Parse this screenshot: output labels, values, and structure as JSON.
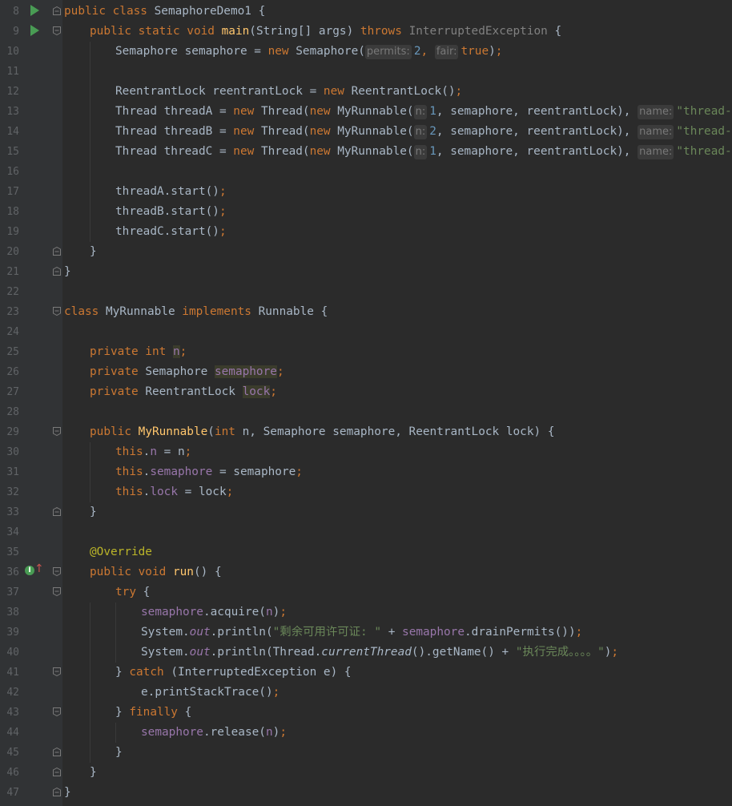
{
  "editor": {
    "line_numbers": [
      "8",
      "9",
      "10",
      "11",
      "12",
      "13",
      "14",
      "15",
      "16",
      "17",
      "18",
      "19",
      "20",
      "21",
      "22",
      "23",
      "24",
      "25",
      "26",
      "27",
      "28",
      "29",
      "30",
      "31",
      "32",
      "33",
      "34",
      "35",
      "36",
      "37",
      "38",
      "39",
      "40",
      "41",
      "42",
      "43",
      "44",
      "45",
      "46",
      "47"
    ],
    "icons": {
      "run": "run-icon",
      "override": "overridden-method-icon",
      "fold": "fold-icon"
    },
    "colors": {
      "background": "#2b2b2b",
      "gutter": "#313335",
      "line_number": "#606366",
      "keyword": "#cc7832",
      "function": "#ffc66d",
      "field": "#9876aa",
      "number": "#6897bb",
      "string": "#6a8759",
      "text": "#a9b7c6",
      "annotation": "#bbb529",
      "run_icon": "#499c54"
    }
  },
  "code": {
    "l8": {
      "t1": "public class ",
      "t2": "SemaphoreDemo1 {"
    },
    "l9": {
      "t1": "public static void ",
      "t2": "main",
      "t3": "(String[] args) ",
      "t4": "throws ",
      "t5": "InterruptedException ",
      "t6": "{"
    },
    "l10": {
      "t1": "Semaphore semaphore = ",
      "t2": "new ",
      "t3": "Semaphore(",
      "h1": "permits:",
      "t4": "2",
      "t5": ", ",
      "h2": "fair:",
      "t6": "true",
      "t7": ")",
      "t8": ";"
    },
    "l12": {
      "t1": "ReentrantLock reentrantLock = ",
      "t2": "new ",
      "t3": "ReentrantLock()",
      "t4": ";"
    },
    "l13": {
      "t1": "Thread threadA = ",
      "t2": "new ",
      "t3": "Thread(",
      "t4": "new ",
      "t5": "MyRunnable(",
      "h1": "n:",
      "t6": "1",
      "t7": ", semaphore, reentrantLock), ",
      "h2": "name:",
      "t8": "\"thread-A\"",
      "t9": ")",
      "t10": ";"
    },
    "l14": {
      "t1": "Thread threadB = ",
      "t2": "new ",
      "t3": "Thread(",
      "t4": "new ",
      "t5": "MyRunnable(",
      "h1": "n:",
      "t6": "2",
      "t7": ", semaphore, reentrantLock), ",
      "h2": "name:",
      "t8": "\"thread-B\"",
      "t9": ")",
      "t10": ";"
    },
    "l15": {
      "t1": "Thread threadC = ",
      "t2": "new ",
      "t3": "Thread(",
      "t4": "new ",
      "t5": "MyRunnable(",
      "h1": "n:",
      "t6": "1",
      "t7": ", semaphore, reentrantLock), ",
      "h2": "name:",
      "t8": "\"thread-C\"",
      "t9": ")",
      "t10": ";"
    },
    "l17": {
      "t1": "threadA.start()",
      "t2": ";"
    },
    "l18": {
      "t1": "threadB.start()",
      "t2": ";"
    },
    "l19": {
      "t1": "threadC.start()",
      "t2": ";"
    },
    "l20": {
      "t1": "}"
    },
    "l21": {
      "t1": "}"
    },
    "l23": {
      "t1": "class ",
      "t2": "MyRunnable ",
      "t3": "implements ",
      "t4": "Runnable {"
    },
    "l25": {
      "t1": "private int ",
      "t2": "n",
      "t3": ";"
    },
    "l26": {
      "t1": "private ",
      "t2": "Semaphore ",
      "t3": "semaphore",
      "t4": ";"
    },
    "l27": {
      "t1": "private ",
      "t2": "ReentrantLock ",
      "t3": "lock",
      "t4": ";"
    },
    "l29": {
      "t1": "public ",
      "t2": "MyRunnable",
      "t3": "(",
      "t4": "int ",
      "t5": "n, Semaphore semaphore, ReentrantLock lock) {"
    },
    "l30": {
      "t1": "this",
      "t2": ".",
      "t3": "n",
      "t4": " = n",
      "t5": ";"
    },
    "l31": {
      "t1": "this",
      "t2": ".",
      "t3": "semaphore",
      "t4": " = semaphore",
      "t5": ";"
    },
    "l32": {
      "t1": "this",
      "t2": ".",
      "t3": "lock",
      "t4": " = lock",
      "t5": ";"
    },
    "l33": {
      "t1": "}"
    },
    "l35": {
      "t1": "@Override"
    },
    "l36": {
      "t1": "public void ",
      "t2": "run",
      "t3": "() {"
    },
    "l37": {
      "t1": "try ",
      "t2": "{"
    },
    "l38": {
      "t1": "semaphore",
      "t2": ".acquire(",
      "t3": "n",
      "t4": ")",
      "t5": ";"
    },
    "l39": {
      "t1": "System.",
      "t2": "out",
      "t3": ".println(",
      "t4": "\"剩余可用许可证: \"",
      "t5": " + ",
      "t6": "semaphore",
      "t7": ".drainPermits())",
      "t8": ";"
    },
    "l40": {
      "t1": "System.",
      "t2": "out",
      "t3": ".println(Thread.",
      "t4": "currentThread",
      "t5": "().getName() + ",
      "t6": "\"执行完成。。。。\"",
      "t7": ")",
      "t8": ";"
    },
    "l41": {
      "t1": "} ",
      "t2": "catch ",
      "t3": "(InterruptedException e) {"
    },
    "l42": {
      "t1": "e.printStackTrace()",
      "t2": ";"
    },
    "l43": {
      "t1": "} ",
      "t2": "finally ",
      "t3": "{"
    },
    "l44": {
      "t1": "semaphore",
      "t2": ".release(",
      "t3": "n",
      "t4": ")",
      "t5": ";"
    },
    "l45": {
      "t1": "}"
    },
    "l46": {
      "t1": "}"
    },
    "l47": {
      "t1": "}"
    }
  }
}
